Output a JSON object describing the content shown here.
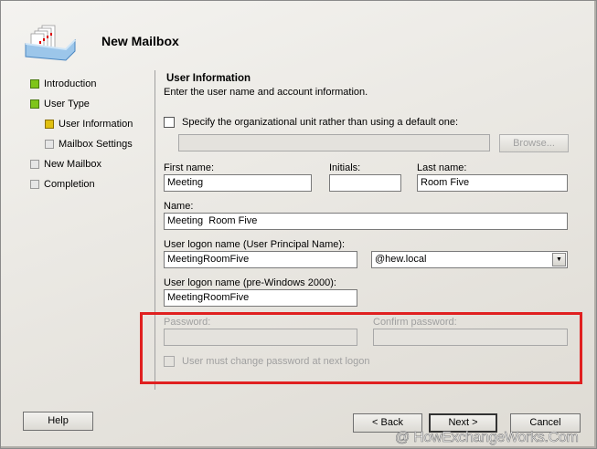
{
  "header": {
    "title": "New Mailbox"
  },
  "nav": [
    {
      "label": "Introduction",
      "state": "done"
    },
    {
      "label": "User Type",
      "state": "done"
    },
    {
      "label": "User Information",
      "state": "current"
    },
    {
      "label": "Mailbox Settings",
      "state": "pending"
    },
    {
      "label": "New Mailbox",
      "state": "pending"
    },
    {
      "label": "Completion",
      "state": "pending"
    }
  ],
  "page": {
    "title": "User Information",
    "subtitle": "Enter the user name and account information."
  },
  "ou": {
    "checkbox_label": "Specify the organizational unit rather than using a default one:",
    "checked": false,
    "value": "",
    "browse_label": "Browse..."
  },
  "fields": {
    "first_name_label": "First name:",
    "first_name": "Meeting",
    "initials_label": "Initials:",
    "initials": "",
    "last_name_label": "Last name:",
    "last_name": "Room Five",
    "name_label": "Name:",
    "name": "Meeting  Room Five",
    "upn_label": "User logon name (User Principal Name):",
    "upn": "MeetingRoomFive",
    "domain": "@hew.local",
    "pre2000_label": "User logon name (pre-Windows 2000):",
    "pre2000": "MeetingRoomFive",
    "password_label": "Password:",
    "password": "",
    "confirm_label": "Confirm password:",
    "confirm": "",
    "must_change_label": "User must change password at next logon",
    "must_change": false
  },
  "buttons": {
    "help": "Help",
    "back": "< Back",
    "next": "Next >",
    "cancel": "Cancel"
  },
  "watermark": "@ HowExchangeWorks.Com",
  "colors": {
    "highlight": "#e02020",
    "done": "#7fc51a",
    "current": "#e0c010"
  }
}
